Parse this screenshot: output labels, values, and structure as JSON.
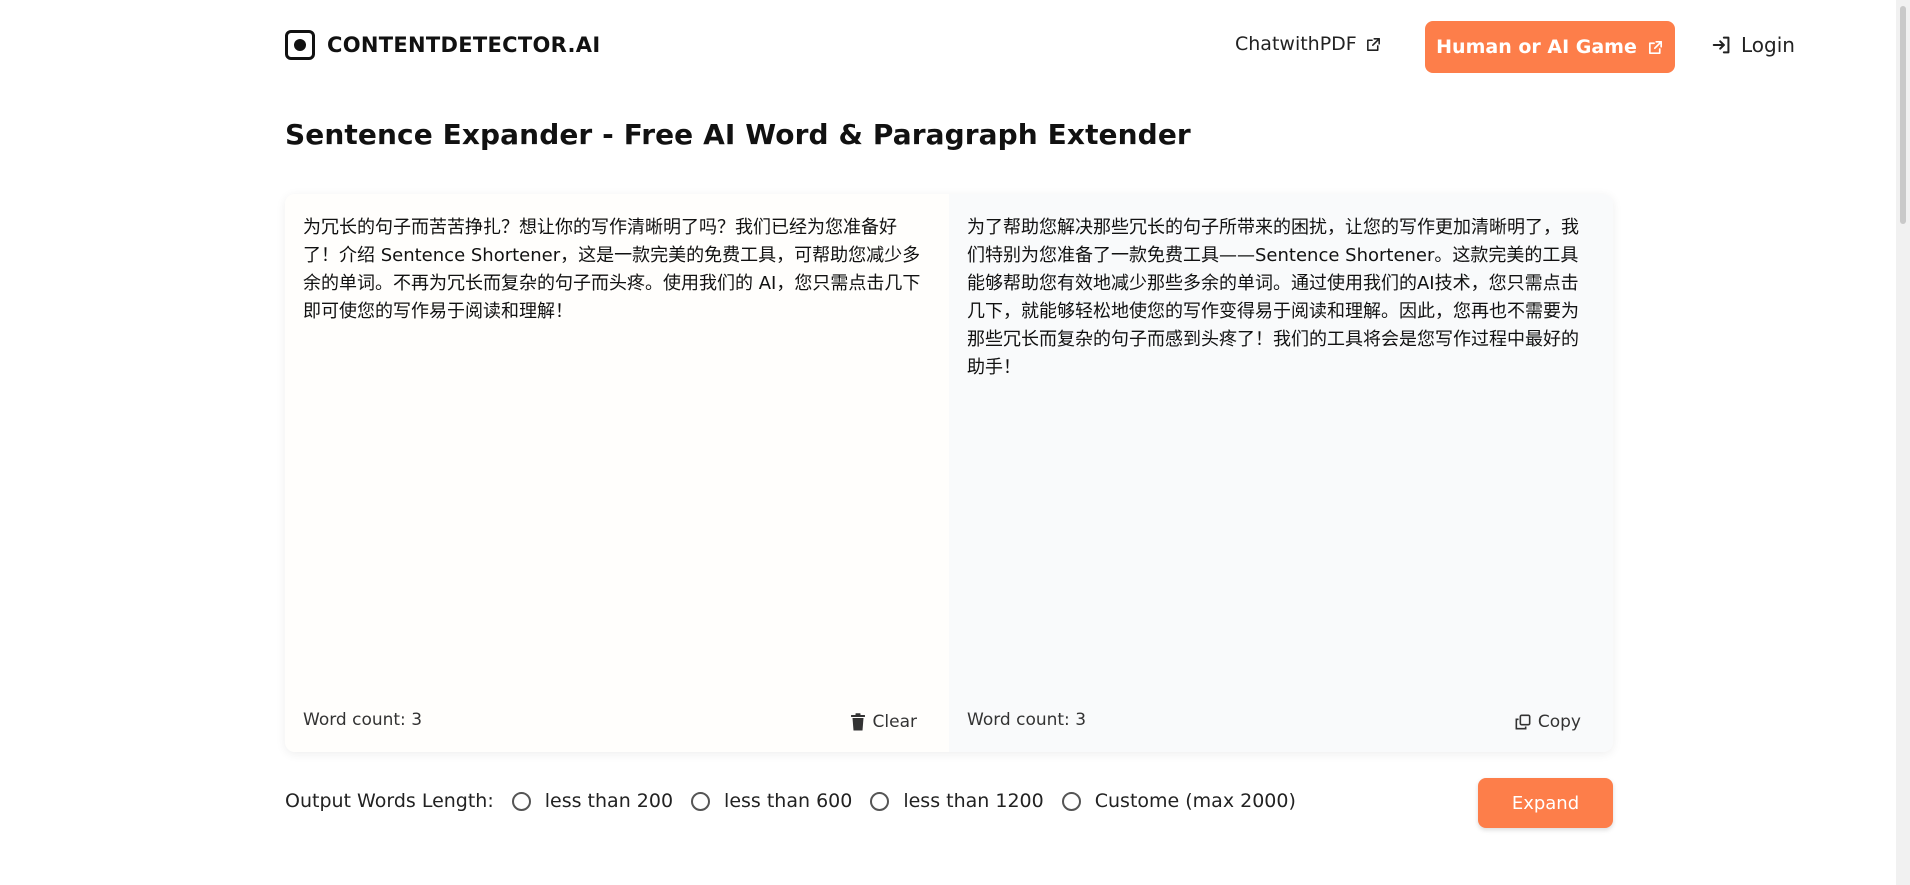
{
  "header": {
    "logo_text": "CONTENTDETECTOR.AI",
    "chat_link": "ChatwithPDF",
    "game_button": "Human or AI Game",
    "login": "Login"
  },
  "page_title": "Sentence Expander - Free AI Word & Paragraph Extender",
  "input_panel": {
    "text": "为冗长的句子而苦苦挣扎？想让你的写作清晰明了吗？我们已经为您准备好了！介绍 Sentence Shortener，这是一款完美的免费工具，可帮助您减少多余的单词。不再为冗长而复杂的句子而头疼。使用我们的 AI，您只需点击几下即可使您的写作易于阅读和理解！",
    "word_count": "Word count: 3",
    "clear_label": "Clear"
  },
  "output_panel": {
    "text": "为了帮助您解决那些冗长的句子所带来的困扰，让您的写作更加清晰明了，我们特别为您准备了一款免费工具——Sentence Shortener。这款完美的工具能够帮助您有效地减少那些多余的单词。通过使用我们的AI技术，您只需点击几下，就能够轻松地使您的写作变得易于阅读和理解。因此，您再也不需要为那些冗长而复杂的句子而感到头疼了！我们的工具将会是您写作过程中最好的助手！",
    "word_count": "Word count: 3",
    "copy_label": "Copy"
  },
  "options": {
    "label": "Output Words Length:",
    "choices": [
      "less than 200",
      "less than 600",
      "less than 1200",
      "Custome (max 2000)"
    ]
  },
  "expand_button": "Expand",
  "colors": {
    "accent": "#fd7e4a"
  }
}
